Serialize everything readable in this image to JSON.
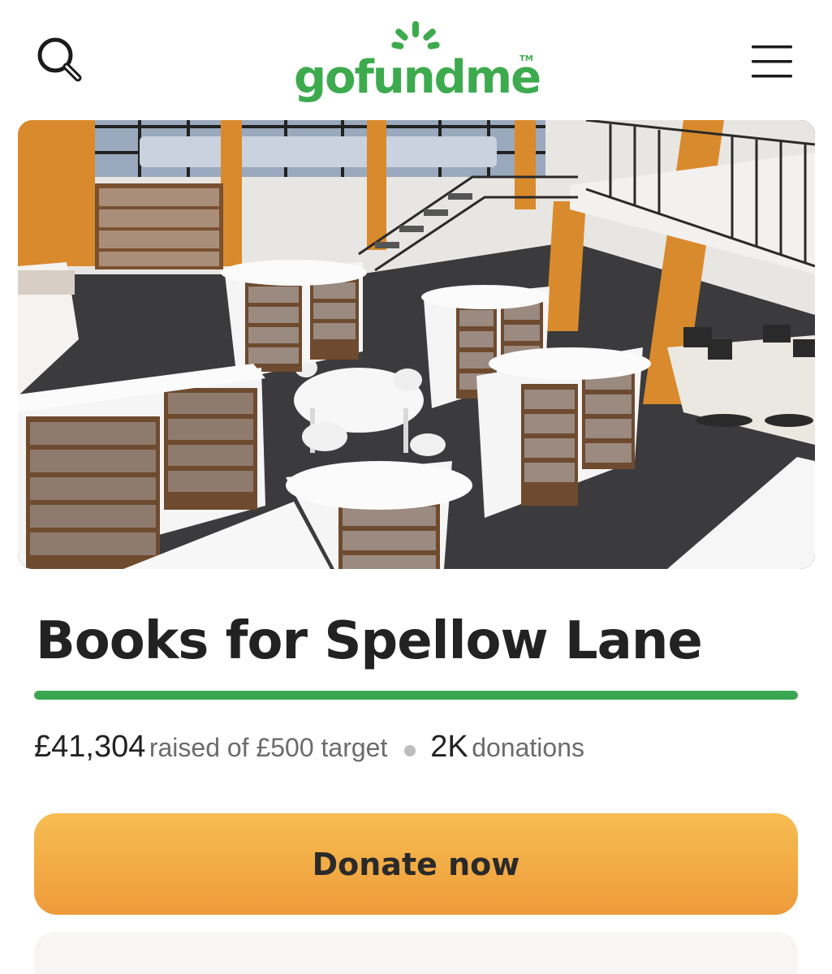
{
  "header": {
    "logo_text": "gofundme",
    "logo_tm": "TM",
    "search_icon": "search-icon",
    "menu_icon": "hamburger-menu-icon"
  },
  "hero": {
    "icon": "campaign-photo-library-interior"
  },
  "campaign": {
    "title": "Books for Spellow Lane",
    "raised_amount": "£41,304",
    "raised_text": "raised of £500 target",
    "donations_count": "2K",
    "donations_text": "donations",
    "progress_fraction": 1.0
  },
  "actions": {
    "donate_label": "Donate now"
  },
  "colors": {
    "brand_green": "#3daa4e",
    "progress_green": "#3aa64f",
    "donate_top": "#f7bd52",
    "donate_bottom": "#ee9b3a"
  }
}
